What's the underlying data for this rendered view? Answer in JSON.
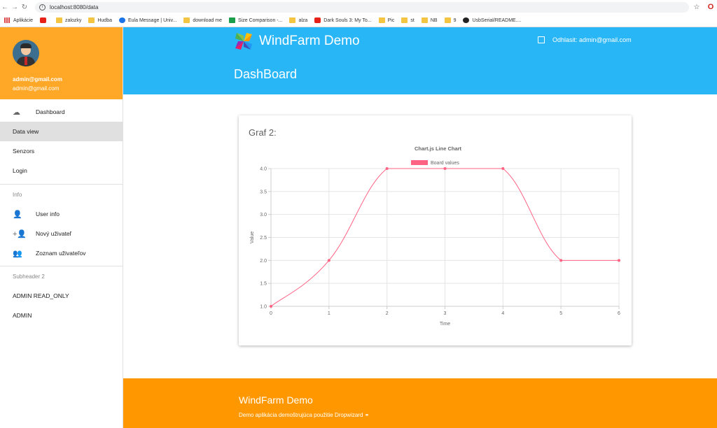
{
  "browser": {
    "url": "localhost:8080/data",
    "bookmarks": [
      {
        "label": "Aplikácie",
        "icon": "apps-grid-icon",
        "color": "grid"
      },
      {
        "label": "",
        "icon": "youtube-icon",
        "color": "yt"
      },
      {
        "label": "zalozky",
        "icon": "folder-icon",
        "color": "folder"
      },
      {
        "label": "Hudba",
        "icon": "folder-icon",
        "color": "folder"
      },
      {
        "label": "Eula Message | Univ...",
        "icon": "site-icon",
        "color": "blue"
      },
      {
        "label": "download me",
        "icon": "folder-icon",
        "color": "folder"
      },
      {
        "label": "Size Comparison -...",
        "icon": "site-icon",
        "color": "green"
      },
      {
        "label": "alza",
        "icon": "folder-icon",
        "color": "folder"
      },
      {
        "label": "Dark Souls 3: My To...",
        "icon": "youtube-icon",
        "color": "yt"
      },
      {
        "label": "Pic",
        "icon": "folder-icon",
        "color": "folder"
      },
      {
        "label": "st",
        "icon": "folder-icon",
        "color": "folder"
      },
      {
        "label": "NB",
        "icon": "folder-icon",
        "color": "folder"
      },
      {
        "label": "9",
        "icon": "folder-icon",
        "color": "folder"
      },
      {
        "label": "UsbSerial/README....",
        "icon": "github-icon",
        "color": "gh"
      }
    ]
  },
  "user": {
    "name": "admin@gmail.com",
    "email": "admin@gmail.com"
  },
  "sidebar": {
    "items": [
      {
        "label": "Dashboard",
        "icon": "cloud-icon",
        "glyph": "☁"
      },
      {
        "label": "Data view",
        "icon": "",
        "glyph": "",
        "active": true
      },
      {
        "label": "Senzors",
        "icon": "",
        "glyph": ""
      },
      {
        "label": "Login",
        "icon": "",
        "glyph": ""
      }
    ],
    "subheader1": "Info",
    "info_items": [
      {
        "label": "User info",
        "icon": "person-icon",
        "glyph": "👤"
      },
      {
        "label": "Nový uživateľ",
        "icon": "person-add-icon",
        "glyph": "+👤"
      },
      {
        "label": "Zoznam uživateľov",
        "icon": "people-icon",
        "glyph": "👥"
      }
    ],
    "subheader2": "Subheader 2",
    "admin_items": [
      {
        "label": "ADMIN READ_ONLY"
      },
      {
        "label": "ADMIN"
      }
    ]
  },
  "header": {
    "brand": "WindFarm Demo",
    "logout": "Odhlasit: admin@gmail.com",
    "page_title": "DashBoard"
  },
  "card": {
    "title": "Graf 2:"
  },
  "chart_data": {
    "type": "line",
    "title": "Chart.js Line Chart",
    "xlabel": "Time",
    "ylabel": "Value",
    "x": [
      0,
      1,
      2,
      3,
      4,
      5,
      6
    ],
    "series": [
      {
        "name": "Board values",
        "values": [
          1,
          2,
          4,
          4,
          4,
          2,
          2
        ],
        "color": "#ff6384"
      }
    ],
    "ylim": [
      1,
      4
    ],
    "yticks": [
      "1.0",
      "1.5",
      "2.0",
      "2.5",
      "3.0",
      "3.5",
      "4.0"
    ],
    "xticks": [
      "0",
      "1",
      "2",
      "3",
      "4",
      "5",
      "6"
    ],
    "grid": true,
    "legend": "top-center"
  },
  "footer": {
    "title": "WindFarm Demo",
    "text": "Demo aplikácia demoštrujúca použitie Dropwizard ⚭"
  },
  "colors": {
    "sidebar_header": "#ffa726",
    "appbar": "#29b6f6",
    "footer": "#ff9800",
    "line": "#ff6384"
  }
}
